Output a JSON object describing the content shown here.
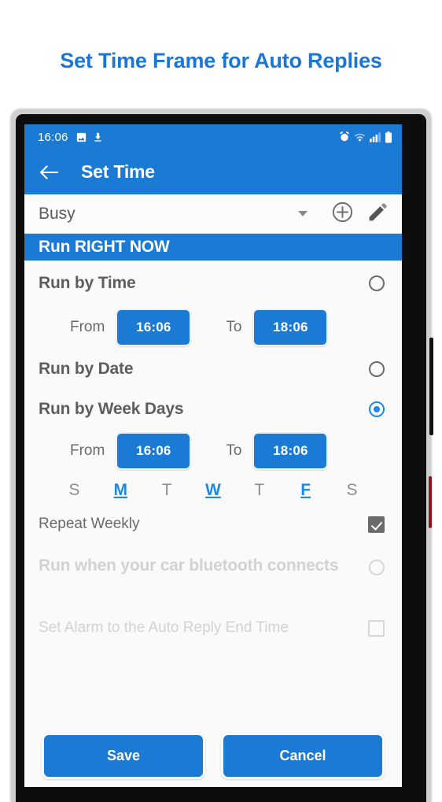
{
  "page": {
    "title": "Set Time Frame for Auto Replies",
    "accent_blue": "#1b7ad4",
    "selected_blue": "#1e88e5"
  },
  "statusbar": {
    "time": "16:06",
    "left_icons": [
      "image-icon",
      "download-icon"
    ],
    "right_icons": [
      "alarm-icon",
      "wifi-icon",
      "signal-icon",
      "battery-icon"
    ]
  },
  "appbar": {
    "back_icon": "back-arrow-icon",
    "title": "Set Time"
  },
  "profile": {
    "name": "Busy",
    "caret_icon": "chevron-down-icon",
    "add_icon": "circle-plus-icon",
    "edit_icon": "pencil-icon"
  },
  "banner": {
    "label": "Run RIGHT NOW"
  },
  "options": {
    "run_by_time": {
      "label": "Run by Time",
      "selected": false,
      "from_label": "From",
      "from_value": "16:06",
      "to_label": "To",
      "to_value": "18:06"
    },
    "run_by_date": {
      "label": "Run by Date",
      "selected": false
    },
    "run_by_week_days": {
      "label": "Run by Week Days",
      "selected": true,
      "from_label": "From",
      "from_value": "16:06",
      "to_label": "To",
      "to_value": "18:06"
    },
    "car_bluetooth": {
      "label": "Run when your car bluetooth connects",
      "selected": false,
      "disabled": true
    }
  },
  "days": [
    {
      "letter": "S",
      "selected": false
    },
    {
      "letter": "M",
      "selected": true
    },
    {
      "letter": "T",
      "selected": false
    },
    {
      "letter": "W",
      "selected": true
    },
    {
      "letter": "T",
      "selected": false
    },
    {
      "letter": "F",
      "selected": true
    },
    {
      "letter": "S",
      "selected": false
    }
  ],
  "repeat_weekly": {
    "label": "Repeat Weekly",
    "checked": true
  },
  "set_alarm": {
    "label": "Set Alarm to the Auto Reply End Time",
    "checked": false,
    "disabled": true
  },
  "actions": {
    "save_label": "Save",
    "cancel_label": "Cancel"
  }
}
